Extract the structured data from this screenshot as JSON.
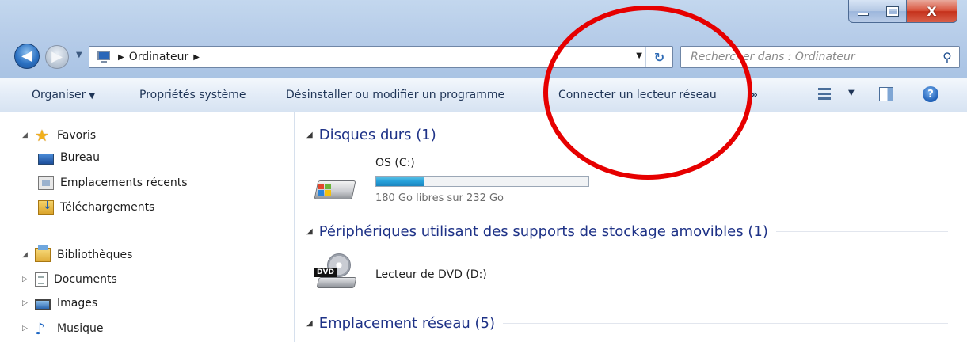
{
  "window": {
    "caption_buttons": [
      "minimize-icon",
      "maximize-icon",
      "close-icon"
    ]
  },
  "navigation": {
    "back_icon": "back-arrow-icon",
    "forward_icon": "forward-arrow-icon",
    "breadcrumb": [
      "Ordinateur"
    ],
    "search_placeholder": "Rechercher dans : Ordinateur"
  },
  "toolbar": {
    "organiser": "Organiser",
    "properties": "Propriétés système",
    "uninstall": "Désinstaller ou modifier un programme",
    "map_drive": "Connecter un lecteur réseau",
    "more": "»"
  },
  "sidebar": {
    "favorites": {
      "label": "Favoris",
      "items": [
        "Bureau",
        "Emplacements récents",
        "Téléchargements"
      ]
    },
    "libraries": {
      "label": "Bibliothèques",
      "items": [
        "Documents",
        "Images",
        "Musique"
      ]
    }
  },
  "content": {
    "groups": [
      {
        "header": "Disques durs (1)",
        "drives": [
          {
            "name": "OS (C:)",
            "free_text": "180 Go libres sur 232 Go",
            "used_fraction": 0.224
          }
        ]
      },
      {
        "header": "Périphériques utilisant des supports de stockage amovibles (1)",
        "drives": [
          {
            "name": "Lecteur de DVD (D:)",
            "badge": "DVD"
          }
        ]
      },
      {
        "header": "Emplacement réseau (5)"
      }
    ]
  },
  "colors": {
    "accent": "#1e3287",
    "capacity_fill": "#26a0da",
    "annotation": "#e60000"
  }
}
